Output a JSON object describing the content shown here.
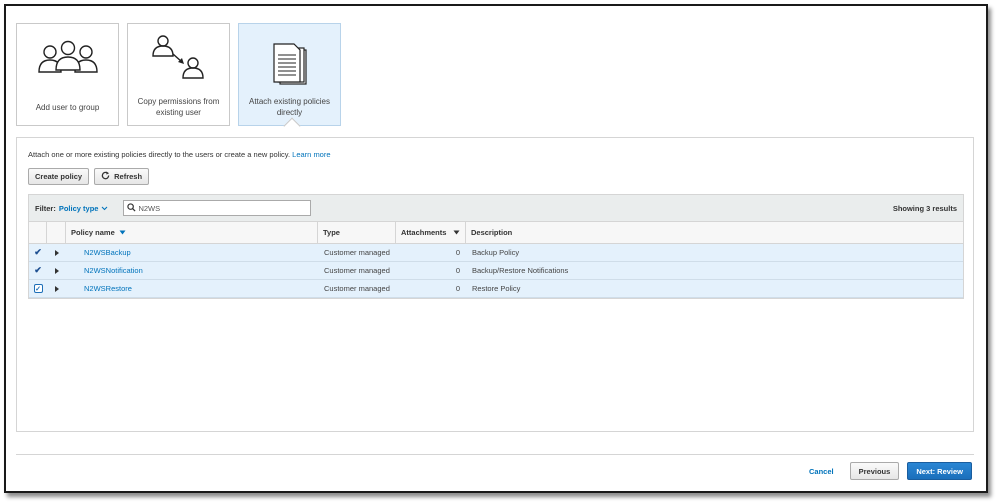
{
  "options": [
    {
      "label": "Add user to group",
      "icon": "group-icon",
      "selected": false
    },
    {
      "label": "Copy permissions from existing user",
      "icon": "copy-permissions-icon",
      "selected": false
    },
    {
      "label": "Attach existing policies directly",
      "icon": "document-icon",
      "selected": true
    }
  ],
  "intro": {
    "text": "Attach one or more existing policies directly to the users or create a new policy.",
    "link": "Learn more"
  },
  "toolbar": {
    "create_policy": "Create policy",
    "refresh": "Refresh"
  },
  "filter": {
    "label": "Filter:",
    "type": "Policy type",
    "search_value": "N2WS",
    "results": "Showing 3 results"
  },
  "table": {
    "headers": {
      "name": "Policy name",
      "type": "Type",
      "attachments": "Attachments",
      "description": "Description"
    },
    "rows": [
      {
        "name": "N2WSBackup",
        "type": "Customer managed",
        "attachments": "0",
        "description": "Backup Policy",
        "checked": true
      },
      {
        "name": "N2WSNotification",
        "type": "Customer managed",
        "attachments": "0",
        "description": "Backup/Restore Notifications",
        "checked": true
      },
      {
        "name": "N2WSRestore",
        "type": "Customer managed",
        "attachments": "0",
        "description": "Restore Policy",
        "checked": true
      }
    ]
  },
  "footer": {
    "cancel": "Cancel",
    "previous": "Previous",
    "next": "Next: Review"
  },
  "colors": {
    "accent": "#0073bb",
    "selected_bg": "#e4f1fc",
    "primary_button": "#1b6fbb"
  }
}
